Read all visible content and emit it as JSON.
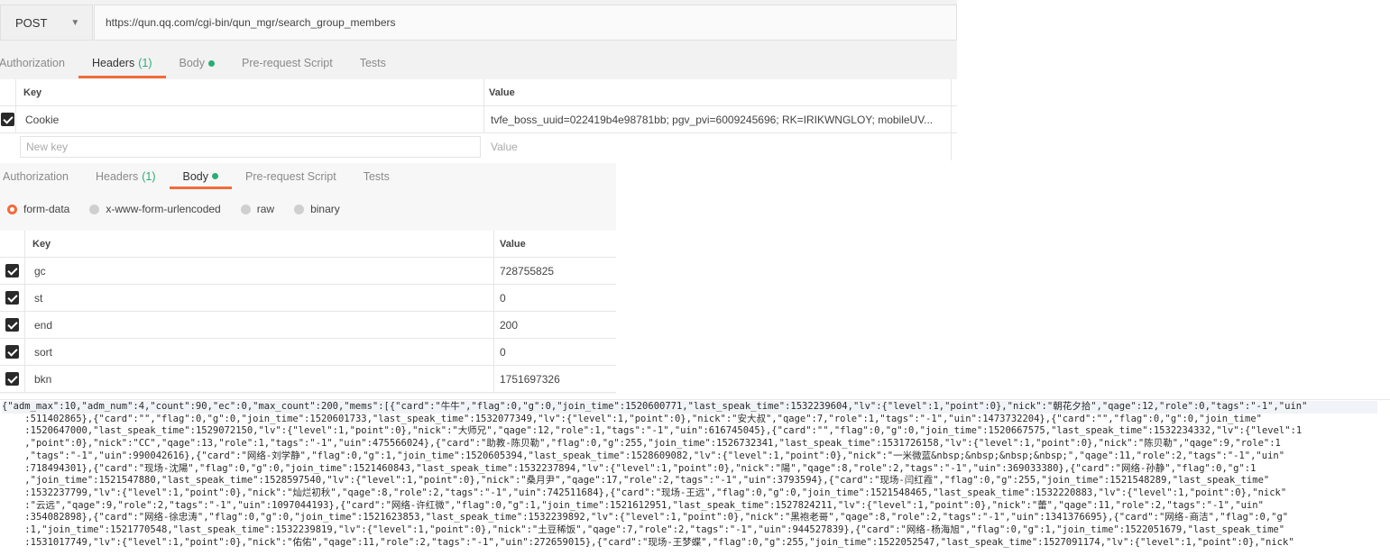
{
  "request": {
    "method": "POST",
    "url": "https://qun.qq.com/cgi-bin/qun_mgr/search_group_members"
  },
  "top_tabs": [
    {
      "label": "Authorization",
      "count": "",
      "dot": false,
      "active": false
    },
    {
      "label": "Headers",
      "count": "(1)",
      "dot": false,
      "active": true
    },
    {
      "label": "Body",
      "count": "",
      "dot": true,
      "active": false
    },
    {
      "label": "Pre-request Script",
      "count": "",
      "dot": false,
      "active": false
    },
    {
      "label": "Tests",
      "count": "",
      "dot": false,
      "active": false
    }
  ],
  "headers_table": {
    "col_key": "Key",
    "col_value": "Value",
    "rows": [
      {
        "key": "Cookie",
        "value": "tvfe_boss_uuid=022419b4e98781bb; pgv_pvi=6009245696; RK=IRIKWNGLOY; mobileUV...",
        "checked": true
      }
    ],
    "new_key_placeholder": "New key",
    "new_value_placeholder": "Value"
  },
  "body_tabs": [
    {
      "label": "Authorization",
      "count": "",
      "dot": false,
      "active": false
    },
    {
      "label": "Headers",
      "count": "(1)",
      "dot": false,
      "active": false
    },
    {
      "label": "Body",
      "count": "",
      "dot": true,
      "active": true
    },
    {
      "label": "Pre-request Script",
      "count": "",
      "dot": false,
      "active": false
    },
    {
      "label": "Tests",
      "count": "",
      "dot": false,
      "active": false
    }
  ],
  "body_types": [
    {
      "label": "form-data",
      "selected": true
    },
    {
      "label": "x-www-form-urlencoded",
      "selected": false
    },
    {
      "label": "raw",
      "selected": false
    },
    {
      "label": "binary",
      "selected": false
    }
  ],
  "form_table": {
    "col_key": "Key",
    "col_value": "Value",
    "rows": [
      {
        "key": "gc",
        "value": "728755825",
        "checked": true
      },
      {
        "key": "st",
        "value": "0",
        "checked": true
      },
      {
        "key": "end",
        "value": "200",
        "checked": true
      },
      {
        "key": "sort",
        "value": "0",
        "checked": true
      },
      {
        "key": "bkn",
        "value": "1751697326",
        "checked": true
      }
    ]
  },
  "response": {
    "lines": [
      "{\"adm_max\":10,\"adm_num\":4,\"count\":90,\"ec\":0,\"max_count\":200,\"mems\":[{\"card\":\"牛牛\",\"flag\":0,\"g\":0,\"join_time\":1520600771,\"last_speak_time\":1532239604,\"lv\":{\"level\":1,\"point\":0},\"nick\":\"朝花夕拾\",\"qage\":12,\"role\":0,\"tags\":\"-1\",\"uin\"",
      "    :511402865},{\"card\":\"\",\"flag\":0,\"g\":0,\"join_time\":1520601733,\"last_speak_time\":1532077349,\"lv\":{\"level\":1,\"point\":0},\"nick\":\"安大叔\",\"qage\":7,\"role\":1,\"tags\":\"-1\",\"uin\":1473732204},{\"card\":\"\",\"flag\":0,\"g\":0,\"join_time\"",
      "    :1520647000,\"last_speak_time\":1529072150,\"lv\":{\"level\":1,\"point\":0},\"nick\":\"大师兄\",\"qage\":12,\"role\":1,\"tags\":\"-1\",\"uin\":616745045},{\"card\":\"\",\"flag\":0,\"g\":0,\"join_time\":1520667575,\"last_speak_time\":1532234332,\"lv\":{\"level\":1",
      "    ,\"point\":0},\"nick\":\"CC\",\"qage\":13,\"role\":1,\"tags\":\"-1\",\"uin\":475566024},{\"card\":\"助教-陈贝勒\",\"flag\":0,\"g\":255,\"join_time\":1526732341,\"last_speak_time\":1531726158,\"lv\":{\"level\":1,\"point\":0},\"nick\":\"陈贝勒\",\"qage\":9,\"role\":1",
      "    ,\"tags\":\"-1\",\"uin\":990042616},{\"card\":\"网络-刘学静\",\"flag\":0,\"g\":1,\"join_time\":1520605394,\"last_speak_time\":1528609082,\"lv\":{\"level\":1,\"point\":0},\"nick\":\"一米微蓝&nbsp;&nbsp;&nbsp;&nbsp;\",\"qage\":11,\"role\":2,\"tags\":\"-1\",\"uin\"",
      "    :718494301},{\"card\":\"现场-沈陽\",\"flag\":0,\"g\":0,\"join_time\":1521460843,\"last_speak_time\":1532237894,\"lv\":{\"level\":1,\"point\":0},\"nick\":\"陽\",\"qage\":8,\"role\":2,\"tags\":\"-1\",\"uin\":369033380},{\"card\":\"网络-孙静\",\"flag\":0,\"g\":1",
      "    ,\"join_time\":1521547880,\"last_speak_time\":1528597540,\"lv\":{\"level\":1,\"point\":0},\"nick\":\"桑月尹\",\"qage\":17,\"role\":2,\"tags\":\"-1\",\"uin\":3793594},{\"card\":\"现场-闫红霞\",\"flag\":0,\"g\":255,\"join_time\":1521548289,\"last_speak_time\"",
      "    :1532237799,\"lv\":{\"level\":1,\"point\":0},\"nick\":\"灿烂初秋\",\"qage\":8,\"role\":2,\"tags\":\"-1\",\"uin\":742511684},{\"card\":\"现场-王远\",\"flag\":0,\"g\":0,\"join_time\":1521548465,\"last_speak_time\":1532220883,\"lv\":{\"level\":1,\"point\":0},\"nick\"",
      "    :\"云远\",\"qage\":9,\"role\":2,\"tags\":\"-1\",\"uin\":1097044193},{\"card\":\"网络-许红微\",\"flag\":0,\"g\":1,\"join_time\":1521612951,\"last_speak_time\":1527824211,\"lv\":{\"level\":1,\"point\":0},\"nick\":\"蕾\",\"qage\":11,\"role\":2,\"tags\":\"-1\",\"uin\"",
      "    :354082898},{\"card\":\"网络-徐忠涛\",\"flag\":0,\"g\":0,\"join_time\":1521623853,\"last_speak_time\":1532239892,\"lv\":{\"level\":1,\"point\":0},\"nick\":\"黑袍老哥\",\"qage\":8,\"role\":2,\"tags\":\"-1\",\"uin\":1341376695},{\"card\":\"网络-商洁\",\"flag\":0,\"g\"",
      "    :1,\"join_time\":1521770548,\"last_speak_time\":1532239819,\"lv\":{\"level\":1,\"point\":0},\"nick\":\"土豆稀饭\",\"qage\":7,\"role\":2,\"tags\":\"-1\",\"uin\":944527839},{\"card\":\"网络-杨海旭\",\"flag\":0,\"g\":1,\"join_time\":1522051679,\"last_speak_time\"",
      "    :1531017749,\"lv\":{\"level\":1,\"point\":0},\"nick\":\"佑佑\",\"qage\":11,\"role\":2,\"tags\":\"-1\",\"uin\":272659015},{\"card\":\"现场-王梦蝶\",\"flag\":0,\"g\":255,\"join_time\":1522052547,\"last_speak_time\":1527091174,\"lv\":{\"level\":1,\"point\":0},\"nick\""
    ]
  }
}
